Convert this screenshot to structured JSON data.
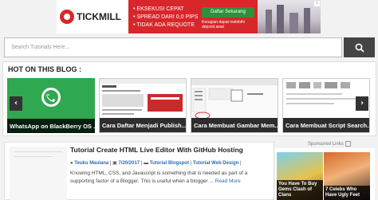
{
  "ad_top": {
    "brand": "TICKMILL",
    "bullets": [
      "• EKSEKUSI CEPAT",
      "• SPREAD DARI 0,0 PIPS",
      "• TIDAK ADA REQUOTE"
    ],
    "cta": "Daftar Sekarang",
    "risk": "Kerugian dapat melebihi deposit awal"
  },
  "search": {
    "placeholder": "Search Tutorials Here..."
  },
  "hot": {
    "title": "HOT ON THIS BLOG :",
    "slides": [
      {
        "caption": "WhatsApp on BlackBerry OS ..."
      },
      {
        "caption": "Cara Daftar Menjadi Publish..."
      },
      {
        "caption": "Cara Membuat Gambar Mem..."
      },
      {
        "caption": "Cara Membuat Script Search..."
      }
    ],
    "prev": "‹",
    "next": "›"
  },
  "sponsored": {
    "label": "Sponsored Links",
    "tiles": [
      {
        "caption": "You Have To Buy Gems Clash of Clans"
      },
      {
        "caption": "7 Celebs Who Have Ugly Feet"
      }
    ]
  },
  "post": {
    "title": "Tutorial Create HTML Live Editor With GitHub Hosting",
    "author": "Teuku Maulana",
    "sep1": " | ",
    "date": "7/20/2017",
    "sep2": " | ",
    "cat1": "Tutorial Blogspot",
    "sep3": " | ",
    "cat2": "Tutorial Web Design",
    "sep4": " |",
    "body": "Knowing HTML, CSS, and Javascript is something that is needed as part of a supporting factor of a Blogger. This is useful when a blogger ...",
    "more": "Read More"
  }
}
